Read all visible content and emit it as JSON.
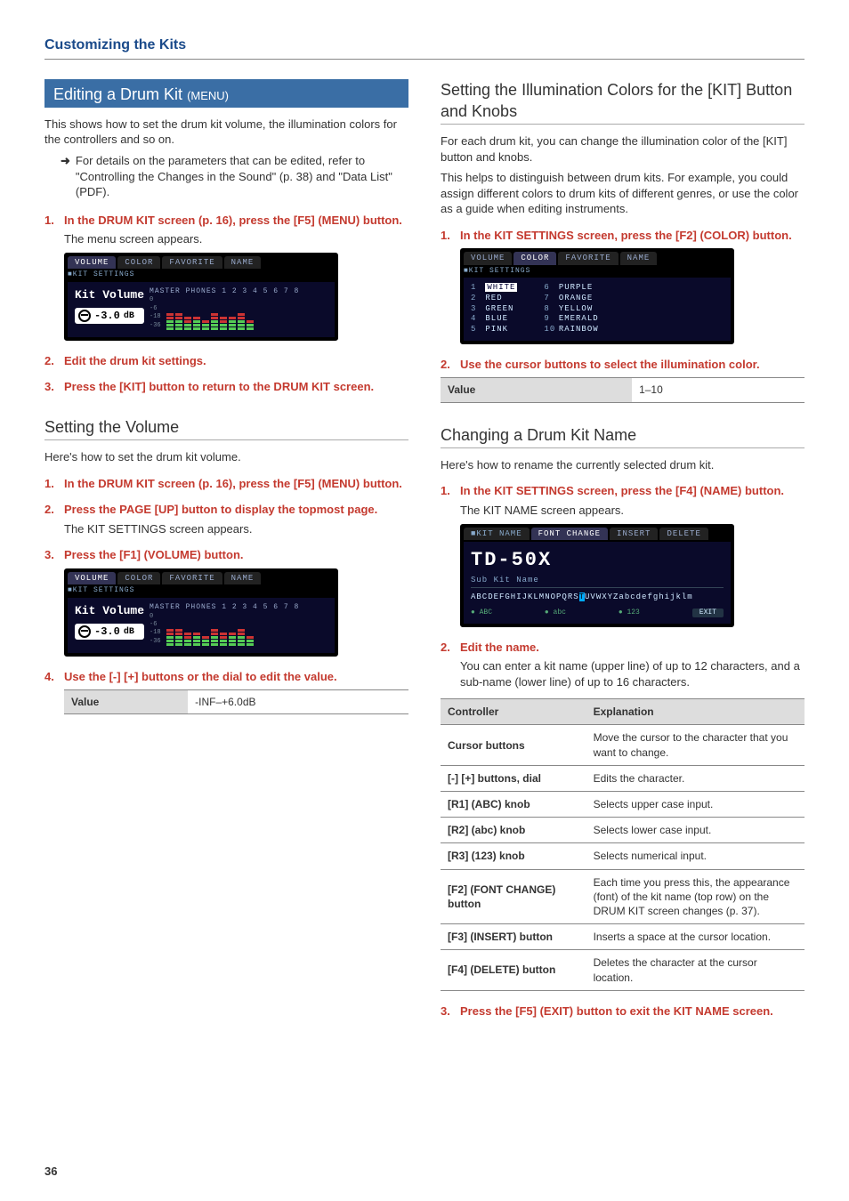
{
  "page": {
    "header": "Customizing the Kits",
    "number": "36"
  },
  "left": {
    "h_bar": "Editing a Drum Kit ",
    "h_bar_sub": "(MENU)",
    "intro": "This shows how to set the drum kit volume, the illumination colors for the controllers and so on.",
    "arrow_note": "For details on the parameters that can be edited, refer to \"Controlling the Changes in the Sound\" (p. 38) and \"Data List\" (PDF).",
    "step1": "In the DRUM KIT screen (p. 16), press the [F5] (MENU) button.",
    "step1_body": "The menu screen appears.",
    "step2": "Edit the drum kit settings.",
    "step3": "Press the [KIT] button to return to the DRUM KIT screen.",
    "h_volume": "Setting the Volume",
    "vol_intro": "Here's how to set the drum kit volume.",
    "vol_step1": "In the DRUM KIT screen (p. 16), press the [F5] (MENU) button.",
    "vol_step2": "Press the PAGE [UP] button to display the topmost page.",
    "vol_step2_body": "The KIT SETTINGS screen appears.",
    "vol_step3": "Press the [F1] (VOLUME) button.",
    "vol_step4": "Use the [-] [+] buttons or the dial to edit the value.",
    "vol_table": {
      "label": "Value",
      "value": "-INF–+6.0dB"
    },
    "scr": {
      "tabs": [
        "VOLUME",
        "COLOR",
        "FAVORITE",
        "NAME"
      ],
      "sub": "■KIT SETTINGS",
      "title": "Kit Volume",
      "badge": "-3.0",
      "badge_unit": "dB",
      "meter_hdr": "MASTER PHONES 1 2 3 4 5 6 7 8",
      "scale": [
        "0",
        "-6",
        "-18",
        "-36"
      ]
    }
  },
  "right": {
    "h_illum": "Setting the Illumination Colors for the [KIT] Button and Knobs",
    "illum_p1": "For each drum kit, you can change the illumination color of the [KIT] button and knobs.",
    "illum_p2": "This helps to distinguish between drum kits. For example, you could assign different colors to drum kits of different genres, or use the color as a guide when editing instruments.",
    "illum_step1": "In the KIT SETTINGS screen, press the [F2] (COLOR) button.",
    "illum_step2": "Use the cursor buttons to select the illumination color.",
    "illum_table": {
      "label": "Value",
      "value": "1–10"
    },
    "color_scr": {
      "tabs": [
        "VOLUME",
        "COLOR",
        "FAVORITE",
        "NAME"
      ],
      "sub": "■KIT SETTINGS",
      "col1": [
        [
          "1",
          "WHITE"
        ],
        [
          "2",
          "RED"
        ],
        [
          "3",
          "GREEN"
        ],
        [
          "4",
          "BLUE"
        ],
        [
          "5",
          "PINK"
        ]
      ],
      "col2": [
        [
          "6",
          "PURPLE"
        ],
        [
          "7",
          "ORANGE"
        ],
        [
          "8",
          "YELLOW"
        ],
        [
          "9",
          "EMERALD"
        ],
        [
          "10",
          "RAINBOW"
        ]
      ]
    },
    "h_name": "Changing a Drum Kit Name",
    "name_intro": "Here's how to rename the currently selected drum kit.",
    "name_step1": "In the KIT SETTINGS screen, press the [F4] (NAME) button.",
    "name_step1_body": "The KIT NAME screen appears.",
    "name_step2": "Edit the name.",
    "name_step2_body": "You can enter a kit name (upper line) of up to 12 characters, and a sub-name (lower line) of up to 16 characters.",
    "name_step3": "Press the [F5] (EXIT) button to exit the KIT NAME screen.",
    "name_scr": {
      "tabs": [
        "KIT NAME",
        "FONT CHANGE",
        "INSERT",
        "DELETE"
      ],
      "big": "TD-50X",
      "sub": "Sub Kit Name",
      "chars_pre": "ABCDEFGHIJKLMNOPQRS",
      "chars_cur": "T",
      "chars_post": "UVWXYZabcdefghijklm",
      "foot": [
        "● ABC",
        "● abc",
        "● 123",
        "EXIT"
      ]
    },
    "ctl_table": {
      "headers": [
        "Controller",
        "Explanation"
      ],
      "rows": [
        [
          "Cursor buttons",
          "Move the cursor to the character that you want to change."
        ],
        [
          "[-] [+] buttons, dial",
          "Edits the character."
        ],
        [
          "[R1] (ABC) knob",
          "Selects upper case input."
        ],
        [
          "[R2] (abc) knob",
          "Selects lower case input."
        ],
        [
          "[R3] (123) knob",
          "Selects numerical input."
        ],
        [
          "[F2] (FONT CHANGE) button",
          "Each time you press this, the appearance (font) of the kit name (top row) on the DRUM KIT screen changes (p. 37)."
        ],
        [
          "[F3] (INSERT) button",
          "Inserts a space at the cursor location."
        ],
        [
          "[F4] (DELETE) button",
          "Deletes the character at the cursor location."
        ]
      ]
    }
  }
}
